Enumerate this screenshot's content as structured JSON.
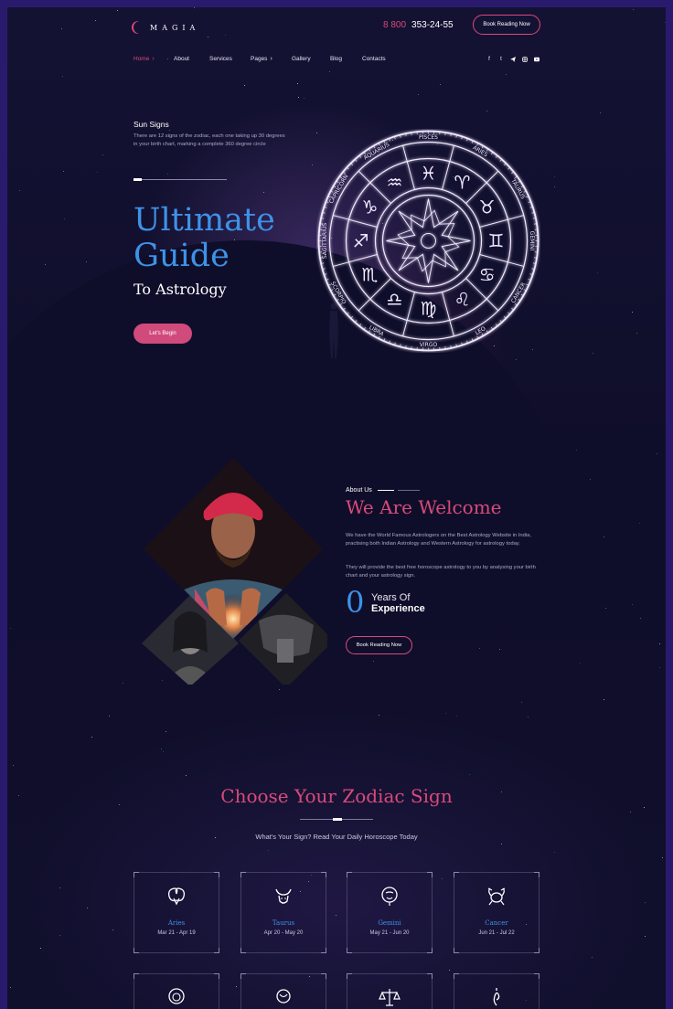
{
  "header": {
    "logo_text": "MAGIA",
    "phone_prefix": "8 800",
    "phone_number": "353-24-55",
    "book_button": "Book Reading Now"
  },
  "nav": {
    "items": [
      {
        "label": "Home",
        "active": true,
        "chevron": true
      },
      {
        "label": "About",
        "active": false,
        "chevron": false
      },
      {
        "label": "Services",
        "active": false,
        "chevron": false
      },
      {
        "label": "Pages",
        "active": false,
        "chevron": true
      },
      {
        "label": "Gallery",
        "active": false,
        "chevron": false
      },
      {
        "label": "Blog",
        "active": false,
        "chevron": false
      },
      {
        "label": "Contacts",
        "active": false,
        "chevron": false
      }
    ],
    "socials": [
      "facebook-icon",
      "twitter-icon",
      "telegram-icon",
      "instagram-icon",
      "youtube-icon"
    ]
  },
  "hero": {
    "sun_title": "Sun Signs",
    "sun_desc": "There are 12 signs of the zodiac, each one taking up 30 degrees in your birth chart, marking a complete 360 degree circle",
    "title_line1": "Ultimate",
    "title_line2": "Guide",
    "subtitle": "To Astrology",
    "cta": "Let's Begin",
    "wheel_labels": [
      "PISCES",
      "ARIES",
      "TAURUS",
      "GEMINI",
      "CANCER",
      "LEO",
      "VIRGO",
      "LIBRA",
      "SCORPIO",
      "SAGITTARIUS",
      "CAPRICORN",
      "AQUARIUS"
    ]
  },
  "about": {
    "label": "About Us",
    "title": "We Are Welcome",
    "p1": "We have the World Famous Astrologers on the Best Astrology Website in India, practising both Indian Astrology and Western Astrology for astrology today.",
    "p2": "They will provide the best free horoscope astrology to you by analysing your birth chart and your astrology sign.",
    "years_value": "0",
    "years_line1": "Years Of",
    "years_line2": "Experience",
    "button": "Book Reading Now"
  },
  "zodiac": {
    "title": "Choose Your Zodiac Sign",
    "subtitle": "What's Your Sign? Read Your Daily Horoscope Today",
    "cards": [
      {
        "name": "Aries",
        "dates": "Mar 21 - Apr 19",
        "icon": "ram-icon"
      },
      {
        "name": "Taurus",
        "dates": "Apr 20 - May 20",
        "icon": "bull-icon"
      },
      {
        "name": "Gemini",
        "dates": "May 21 - Jun 20",
        "icon": "twins-icon"
      },
      {
        "name": "Cancer",
        "dates": "Jun 21 - Jul 22",
        "icon": "crab-icon"
      },
      {
        "name": "",
        "dates": "",
        "icon": "lion-icon"
      },
      {
        "name": "",
        "dates": "",
        "icon": "virgo-icon"
      },
      {
        "name": "",
        "dates": "",
        "icon": "scales-icon"
      },
      {
        "name": "",
        "dates": "",
        "icon": "scorpion-icon"
      }
    ]
  },
  "colors": {
    "background": "#0f0e2a",
    "frame": "#2a1a6e",
    "accent_pink": "#d94a7a",
    "accent_blue": "#3e92e8"
  }
}
